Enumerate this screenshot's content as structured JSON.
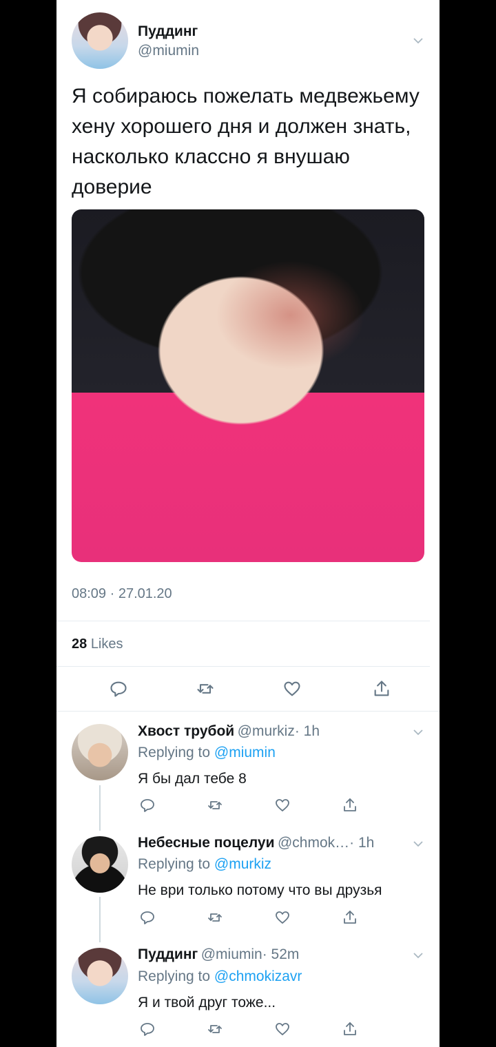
{
  "tweet": {
    "author_name": "Пуддинг",
    "author_handle": "@miumin",
    "text": "Я собираюсь пожелать медвежьему хену хорошего дня и должен знать, насколько классно я внушаю доверие",
    "timestamp": "08:09 · 27.01.20",
    "likes_count": "28",
    "likes_label": "Likes"
  },
  "replies": [
    {
      "name": "Хвост трубой",
      "handle": "@murkiz",
      "time": "· 1h",
      "replying_prefix": "Replying to",
      "replying_to": "@miumin",
      "text": "Я бы дал тебе 8"
    },
    {
      "name": "Небесные поцелуи",
      "handle": "@chmok…",
      "time": "· 1h",
      "replying_prefix": "Replying to",
      "replying_to": "@murkiz",
      "text": "Не ври только потому что вы друзья"
    },
    {
      "name": "Пуддинг",
      "handle": "@miumin",
      "time": "· 52m",
      "replying_prefix": "Replying to",
      "replying_to": "@chmokizavr",
      "text": "Я и твой друг тоже..."
    }
  ],
  "icons": [
    "reply-icon",
    "retweet-icon",
    "like-icon",
    "share-icon",
    "chevron-down-icon"
  ],
  "colors": {
    "link": "#1da1f2",
    "muted": "#657786",
    "text": "#14171a",
    "background": "#000000"
  }
}
